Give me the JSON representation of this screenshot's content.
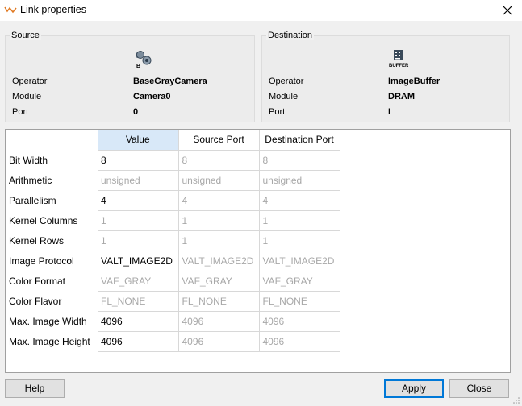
{
  "window": {
    "title": "Link properties"
  },
  "source": {
    "group_title": "Source",
    "icon": "camera-operator-icon",
    "icon_caption": "B",
    "labels": {
      "operator": "Operator",
      "module": "Module",
      "port": "Port"
    },
    "values": {
      "operator": "BaseGrayCamera",
      "module": "Camera0",
      "port": "0"
    }
  },
  "destination": {
    "group_title": "Destination",
    "icon": "buffer-operator-icon",
    "icon_caption": "BUFFER",
    "labels": {
      "operator": "Operator",
      "module": "Module",
      "port": "Port"
    },
    "values": {
      "operator": "ImageBuffer",
      "module": "DRAM",
      "port": "I"
    }
  },
  "table": {
    "columns": [
      "Value",
      "Source Port",
      "Destination Port"
    ],
    "rows": [
      {
        "label": "Bit Width",
        "value": "8",
        "source": "8",
        "destination": "8"
      },
      {
        "label": "Arithmetic",
        "value": "unsigned",
        "source": "unsigned",
        "destination": "unsigned"
      },
      {
        "label": "Parallelism",
        "value": "4",
        "source": "4",
        "destination": "4"
      },
      {
        "label": "Kernel Columns",
        "value": "1",
        "source": "1",
        "destination": "1"
      },
      {
        "label": "Kernel Rows",
        "value": "1",
        "source": "1",
        "destination": "1"
      },
      {
        "label": "Image Protocol",
        "value": "VALT_IMAGE2D",
        "source": "VALT_IMAGE2D",
        "destination": "VALT_IMAGE2D"
      },
      {
        "label": "Color Format",
        "value": "VAF_GRAY",
        "source": "VAF_GRAY",
        "destination": "VAF_GRAY"
      },
      {
        "label": "Color Flavor",
        "value": "FL_NONE",
        "source": "FL_NONE",
        "destination": "FL_NONE"
      },
      {
        "label": "Max. Image Width",
        "value": "4096",
        "source": "4096",
        "destination": "4096"
      },
      {
        "label": "Max. Image Height",
        "value": "4096",
        "source": "4096",
        "destination": "4096"
      }
    ]
  },
  "buttons": {
    "help": "Help",
    "apply": "Apply",
    "close": "Close"
  },
  "colors": {
    "selected_header": "#d8e8f8",
    "readonly_text": "#a8a8a8",
    "default_button_border": "#0078d7"
  }
}
